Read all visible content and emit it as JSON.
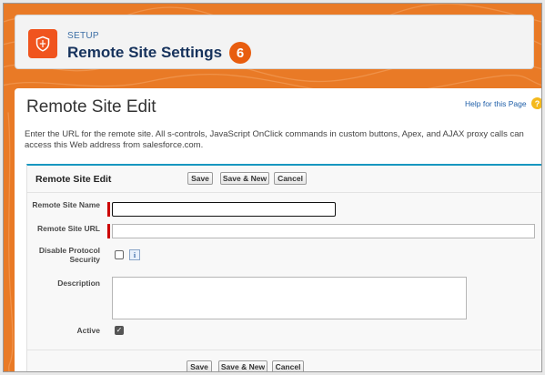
{
  "header": {
    "section_label": "SETUP",
    "title": "Remote Site Settings",
    "badge": "6",
    "icon": "shield-icon"
  },
  "page": {
    "title": "Remote Site Edit",
    "help_link": "Help for this Page",
    "help_icon": "?",
    "intro": "Enter the URL for the remote site. All s-controls, JavaScript OnClick commands in custom buttons, Apex, and AJAX proxy calls can access this Web address from salesforce.com."
  },
  "form": {
    "block_title": "Remote Site Edit",
    "buttons": {
      "save": "Save",
      "save_new": "Save & New",
      "cancel": "Cancel"
    },
    "fields": {
      "name": {
        "label": "Remote Site Name",
        "value": ""
      },
      "url": {
        "label": "Remote Site URL",
        "value": ""
      },
      "disable_security": {
        "label": "Disable Protocol Security",
        "checked": false,
        "info": "i"
      },
      "description": {
        "label": "Description",
        "value": ""
      },
      "active": {
        "label": "Active",
        "checked": true
      }
    }
  },
  "colors": {
    "accent_orange": "#e97a26",
    "setup_icon": "#f0541e",
    "badge": "#e85d0f",
    "block_border": "#1797c0",
    "required": "#cc0000",
    "link": "#1f5fa8"
  }
}
